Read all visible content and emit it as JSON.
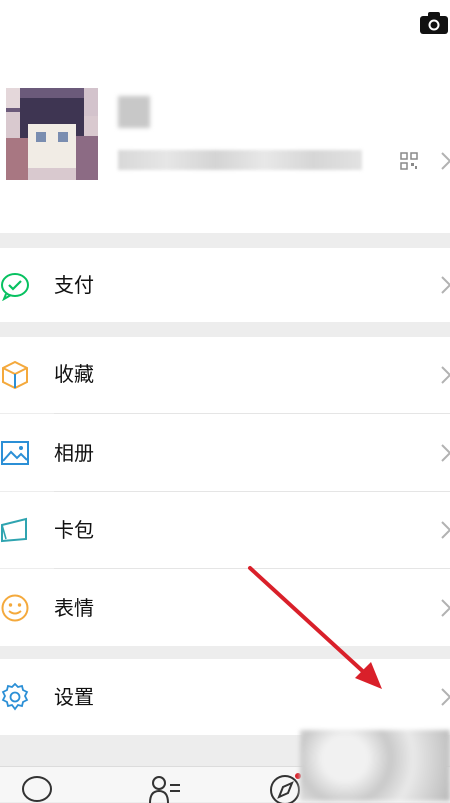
{
  "menu": {
    "pay": "支付",
    "favorites": "收藏",
    "album": "相册",
    "wallet": "卡包",
    "stickers": "表情",
    "settings": "设置"
  },
  "colors": {
    "accent_green": "#07c160",
    "annotation_red": "#d9202a",
    "favorites_orange": "#f4a93c",
    "icon_blue": "#2b8fd6"
  },
  "icons": [
    "camera-icon",
    "qr-code-icon",
    "chevron-right-icon",
    "pay-icon",
    "favorites-icon",
    "album-icon",
    "wallet-icon",
    "stickers-icon",
    "settings-icon",
    "chat-tab-icon",
    "contacts-tab-icon",
    "discover-tab-icon"
  ]
}
